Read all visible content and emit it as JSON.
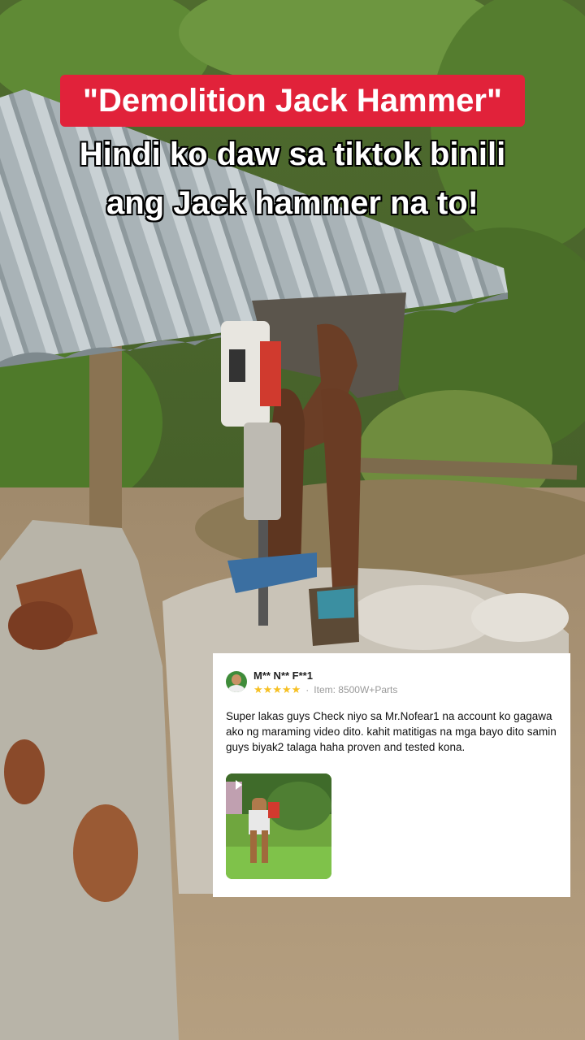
{
  "overlay": {
    "title": "\"Demolition Jack Hammer\"",
    "caption_line1": "Hindi ko daw sa tiktok binili",
    "caption_line2": "ang Jack hammer na to!"
  },
  "review": {
    "reviewer": "M** N** F**1",
    "rating": 5,
    "separator": "·",
    "item": "Item: 8500W+Parts",
    "text": "Super lakas guys Check niyo sa Mr.Nofear1 na account ko gagawa ako ng maraming  video dito. kahit matitigas na mga bayo dito samin guys biyak2 talaga haha proven and tested kona.",
    "star_color": "#f6c023"
  },
  "colors": {
    "title_bg": "#e1223a"
  }
}
